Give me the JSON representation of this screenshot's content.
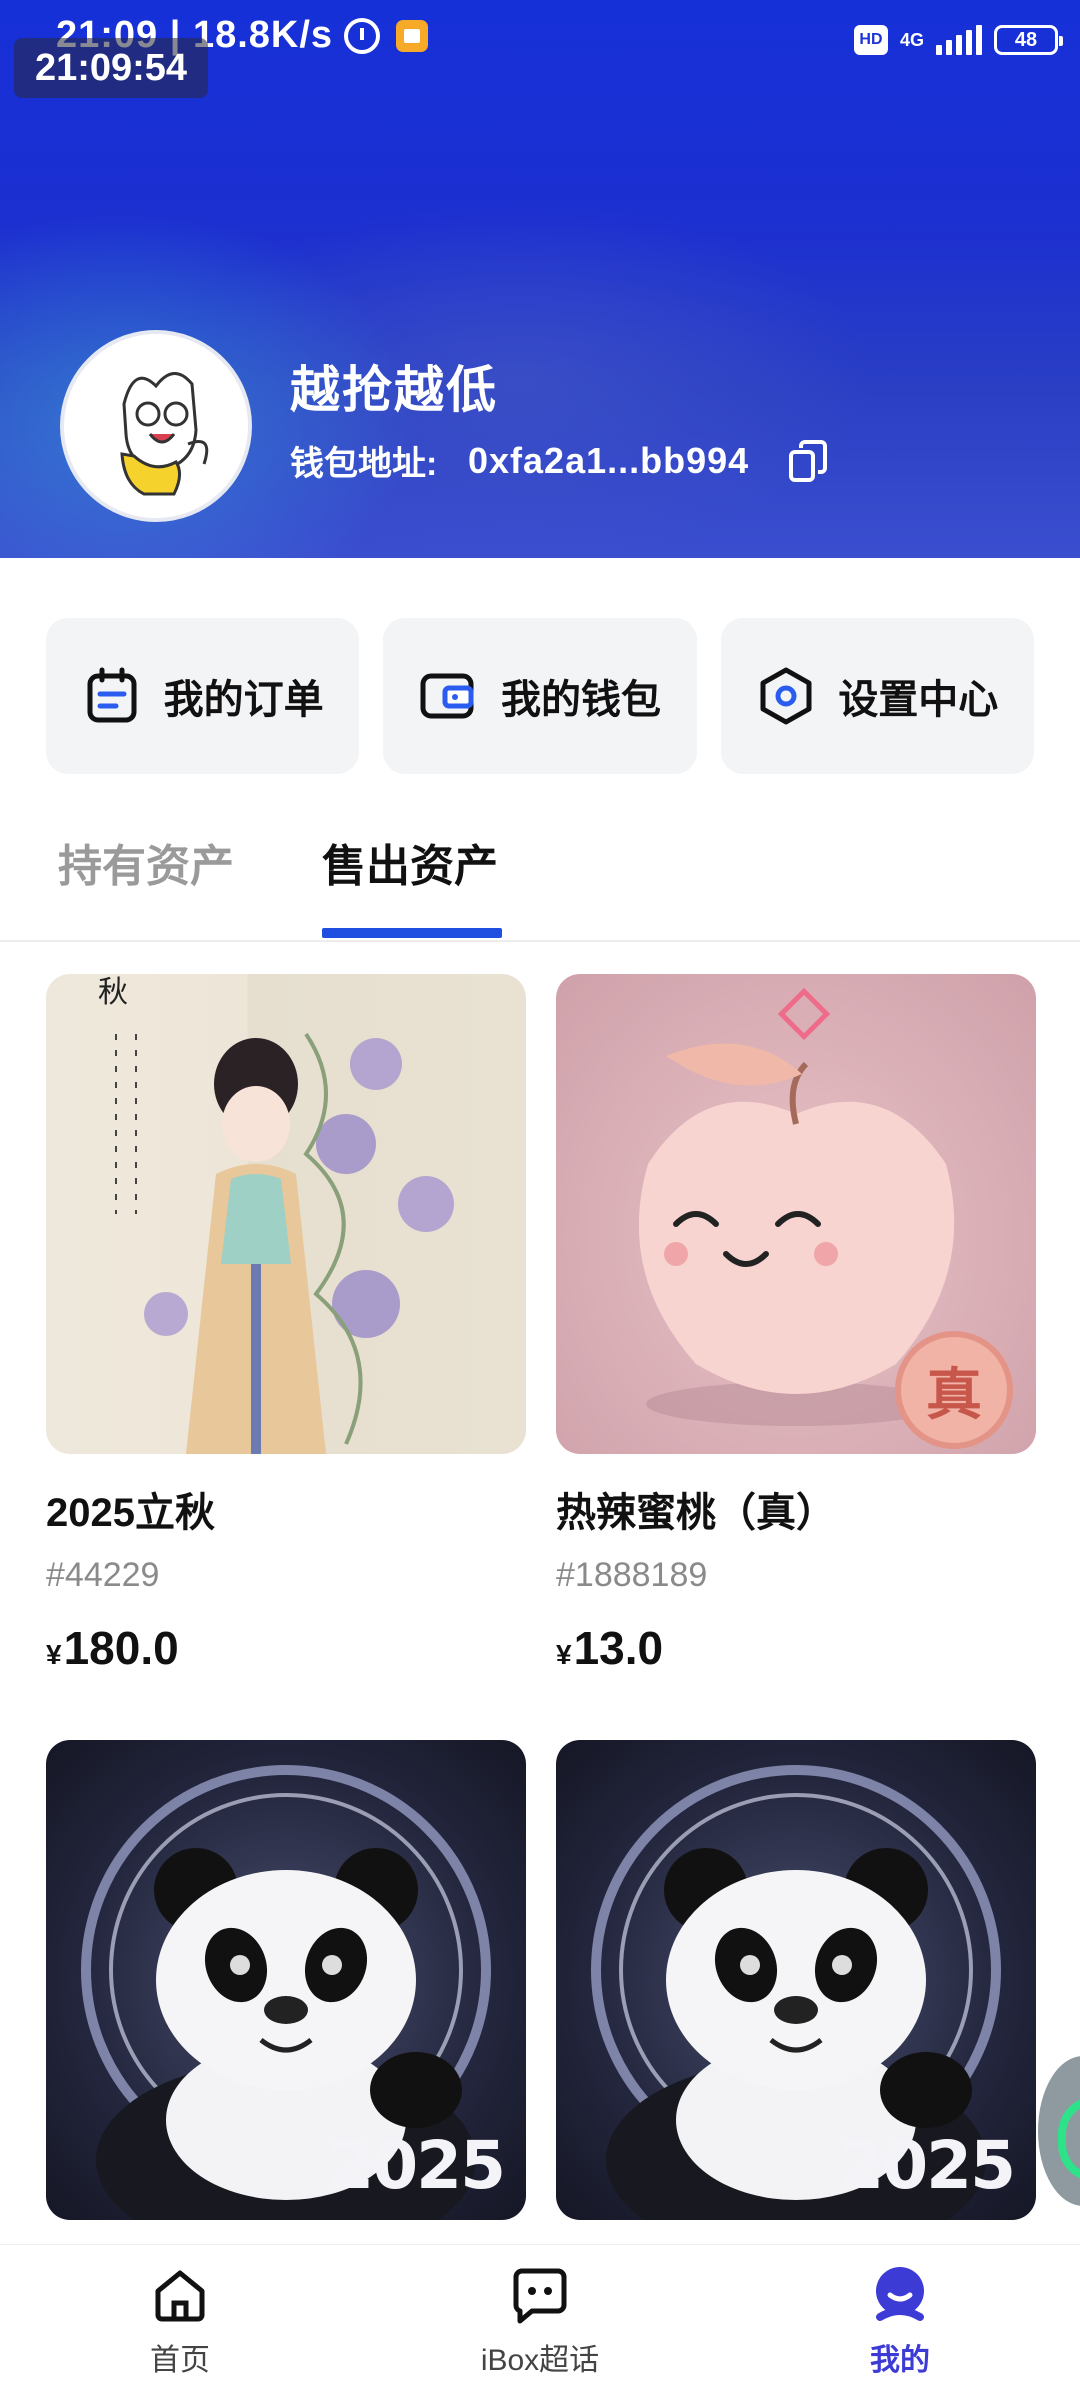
{
  "status_bar": {
    "time": "21:09",
    "speed": "18.8K/s",
    "timer_overlay": "21:09:54",
    "hd": "HD",
    "network": "4G",
    "battery": "48"
  },
  "profile": {
    "username": "越抢越低",
    "wallet_label": "钱包地址:",
    "wallet_address": "0xfa2a1...bb994"
  },
  "actions": [
    {
      "label": "我的订单",
      "icon": "order-icon"
    },
    {
      "label": "我的钱包",
      "icon": "wallet-icon"
    },
    {
      "label": "设置中心",
      "icon": "settings-icon"
    }
  ],
  "tabs": {
    "held": "持有资产",
    "sold": "售出资产",
    "active": "售出资产"
  },
  "assets": [
    {
      "title": "2025立秋",
      "serial": "#44229",
      "currency": "¥",
      "price": "180.0"
    },
    {
      "title": "热辣蜜桃（真）",
      "serial": "#1888189",
      "currency": "¥",
      "price": "13.0"
    },
    {
      "title": "",
      "serial": "",
      "currency": "",
      "price": "",
      "overlay": "2025"
    },
    {
      "title": "",
      "serial": "",
      "currency": "",
      "price": "",
      "overlay": "2025"
    }
  ],
  "nav": {
    "home": "首页",
    "ibox": "iBox超话",
    "mine": "我的",
    "active": "我的"
  },
  "colors": {
    "accent": "#1f4fe0",
    "nav_active": "#3d3bd6",
    "header_blue": "#1c2fd0"
  }
}
